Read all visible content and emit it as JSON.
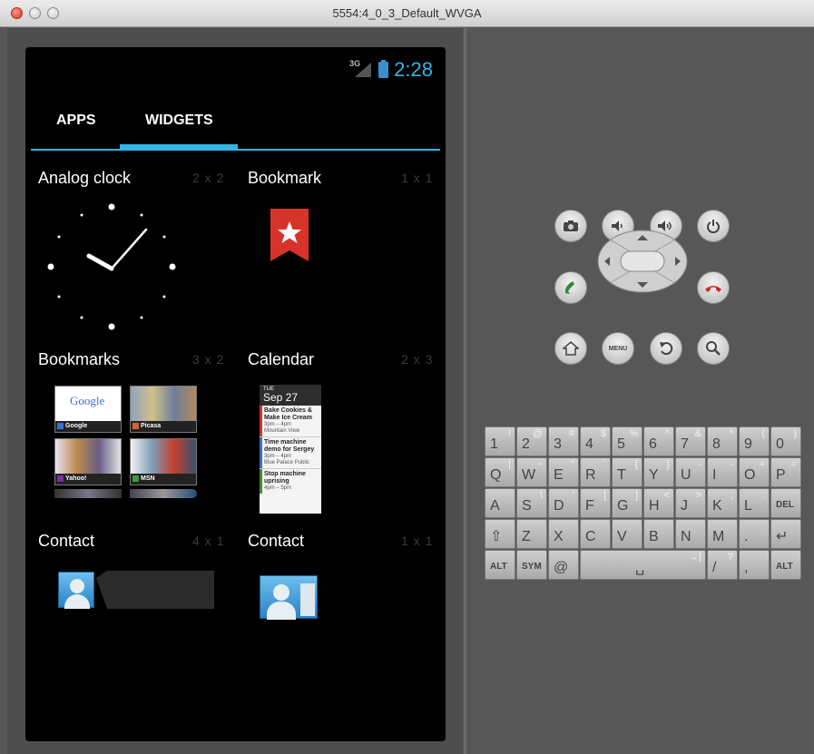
{
  "window": {
    "title": "5554:4_0_3_Default_WVGA"
  },
  "status_bar": {
    "network": "3G",
    "time": "2:28"
  },
  "tabs": [
    {
      "label": "APPS",
      "selected": false
    },
    {
      "label": "WIDGETS",
      "selected": true
    }
  ],
  "widgets": [
    {
      "name": "Analog clock",
      "size": "2 x 2"
    },
    {
      "name": "Bookmark",
      "size": "1 x 1"
    },
    {
      "name": "Bookmarks",
      "size": "3 x 2"
    },
    {
      "name": "Calendar",
      "size": "2 x 3"
    },
    {
      "name": "Contact",
      "size": "4 x 1"
    },
    {
      "name": "Contact",
      "size": "1 x 1"
    }
  ],
  "bookmarks_preview": [
    {
      "title": "Google"
    },
    {
      "title": "Picasa"
    },
    {
      "title": "Yahoo!"
    },
    {
      "title": "MSN"
    }
  ],
  "google_logo": "Google",
  "calendar_preview": {
    "day_of_week": "TUE",
    "date": "Sep 27",
    "events": [
      {
        "title": "Bake Cookies & Make Ice Cream",
        "time": "3pm – 4pm",
        "location": "Mountain View"
      },
      {
        "title": "Time machine demo for Sergey",
        "time": "3pm – 4pm",
        "location": "Blue Palace Public"
      },
      {
        "title": "Stop machine uprising",
        "time": "4pm – 5pm",
        "location": ""
      }
    ]
  },
  "controls": {
    "top_row": [
      "camera-icon",
      "volume-down-icon",
      "volume-up-icon",
      "power-icon"
    ],
    "middle_row": [
      "call-icon",
      "dpad",
      "end-call-icon"
    ],
    "bottom_row": [
      "home-icon",
      "menu",
      "back-icon",
      "search-icon"
    ],
    "menu_label": "MENU"
  },
  "keyboard": {
    "row1": [
      {
        "main": "1",
        "alt": "!"
      },
      {
        "main": "2",
        "alt": "@"
      },
      {
        "main": "3",
        "alt": "#"
      },
      {
        "main": "4",
        "alt": "$"
      },
      {
        "main": "5",
        "alt": "%"
      },
      {
        "main": "6",
        "alt": "^"
      },
      {
        "main": "7",
        "alt": "&"
      },
      {
        "main": "8",
        "alt": "*"
      },
      {
        "main": "9",
        "alt": "("
      },
      {
        "main": "0",
        "alt": ")"
      }
    ],
    "row2": [
      {
        "main": "Q",
        "alt": "|"
      },
      {
        "main": "W",
        "alt": "~"
      },
      {
        "main": "E",
        "alt": "\""
      },
      {
        "main": "R",
        "alt": "`"
      },
      {
        "main": "T",
        "alt": "{"
      },
      {
        "main": "Y",
        "alt": "}"
      },
      {
        "main": "U",
        "alt": "-"
      },
      {
        "main": "I",
        "alt": "-"
      },
      {
        "main": "O",
        "alt": "+"
      },
      {
        "main": "P",
        "alt": "="
      }
    ],
    "row3": [
      {
        "main": "A",
        "alt": ""
      },
      {
        "main": "S",
        "alt": "\\"
      },
      {
        "main": "D",
        "alt": "'"
      },
      {
        "main": "F",
        "alt": "["
      },
      {
        "main": "G",
        "alt": "]"
      },
      {
        "main": "H",
        "alt": "<"
      },
      {
        "main": "J",
        "alt": ">"
      },
      {
        "main": "K",
        "alt": ";"
      },
      {
        "main": "L",
        "alt": ":"
      },
      {
        "main": "DEL",
        "alt": ""
      }
    ],
    "row4": [
      {
        "main": "⇧",
        "alt": ""
      },
      {
        "main": "Z",
        "alt": ""
      },
      {
        "main": "X",
        "alt": ""
      },
      {
        "main": "C",
        "alt": ""
      },
      {
        "main": "V",
        "alt": ""
      },
      {
        "main": "B",
        "alt": ""
      },
      {
        "main": "N",
        "alt": ""
      },
      {
        "main": "M",
        "alt": ""
      },
      {
        "main": ".",
        "alt": ""
      },
      {
        "main": "↵",
        "alt": ""
      }
    ],
    "row5": [
      {
        "main": "ALT",
        "alt": ""
      },
      {
        "main": "SYM",
        "alt": ""
      },
      {
        "main": "@",
        "alt": ""
      },
      {
        "main": "␣",
        "alt": "→|"
      },
      {
        "main": "/",
        "alt": "?"
      },
      {
        "main": ",",
        "alt": ""
      },
      {
        "main": "ALT",
        "alt": ""
      }
    ]
  },
  "colors": {
    "accent": "#33b5e5",
    "bookmark_red": "#d8332a"
  }
}
